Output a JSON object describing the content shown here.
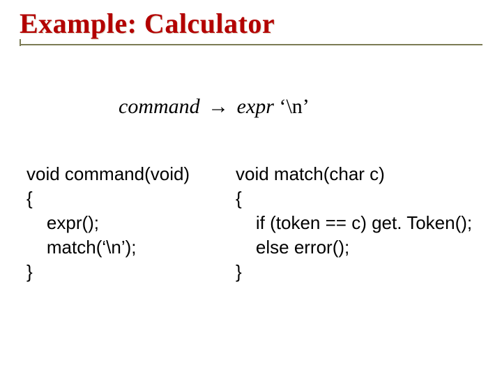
{
  "slide": {
    "title": "Example: Calculator",
    "grammar": {
      "lhs": "command",
      "arrow": "→",
      "rhs_ident": "expr",
      "rhs_literal": " ‘\\n’"
    },
    "code_left": "void command(void)\n{\n    expr();\n    match(‘\\n’);\n}",
    "code_right": "void match(char c)\n{\n    if (token == c) get. Token();\n    else error();\n}"
  }
}
